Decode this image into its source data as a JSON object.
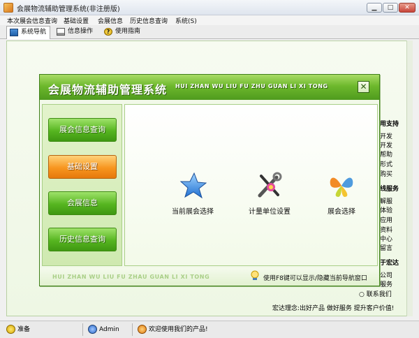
{
  "window": {
    "title": "会展物流辅助管理系统(非注册版)"
  },
  "menu": [
    "本次展会信息查询",
    "基础设置",
    "会展信息",
    "历史信息查询",
    "系统(S)"
  ],
  "tabs": [
    "系统导航",
    "信息操作",
    "使用指南"
  ],
  "nav": {
    "title_cn": "会展物流辅助管理系统",
    "title_py": "HUI ZHAN WU LIU FU ZHU GUAN LI XI TONG",
    "buttons": [
      "展会信息查询",
      "基础设置",
      "会展信息",
      "历史信息查询"
    ],
    "selected_button": "基础设置",
    "functions": [
      "当前展会选择",
      "计量单位设置",
      "展会选择"
    ],
    "footer_py": "HUI ZHAN WU LIU FU ZHAU GUAN LI XI TONG",
    "hint": "使用F8键可以显示/隐藏当前导航窗口"
  },
  "side": {
    "heading1": "用支持",
    "lines1": [
      "开发",
      "开发",
      "帮助",
      "形式",
      "购买"
    ],
    "heading2": "线服务",
    "lines2": [
      "解服",
      "体验",
      "应用",
      "资料",
      "中心",
      "留言"
    ],
    "heading3": "于宏达",
    "lines3": [
      "公司",
      "服务"
    ],
    "contact": "联系我们"
  },
  "slogan": "宏达理念:出好产品 做好服务 提升客户价值!",
  "status": {
    "ready": "准备",
    "user": "Admin",
    "welcome": "欢迎使用我们的产品!"
  },
  "colors": {
    "accent_green": "#4f9b1e",
    "selected_orange": "#f7951f"
  }
}
